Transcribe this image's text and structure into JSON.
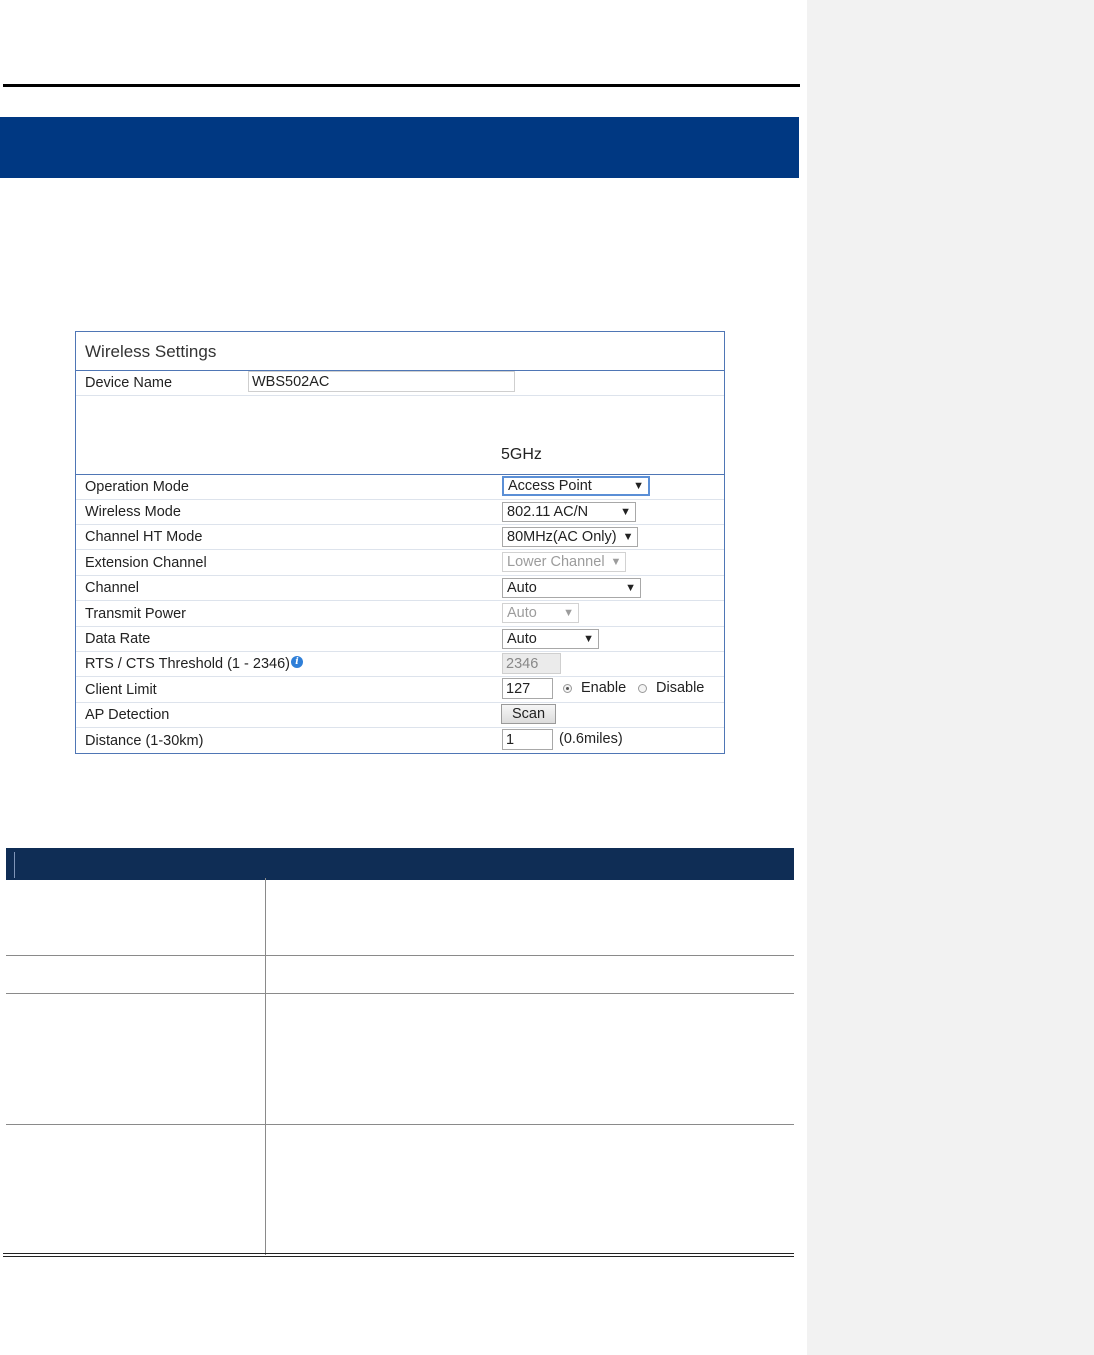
{
  "panel": {
    "title": "Wireless Settings",
    "device_name": {
      "label": "Device Name",
      "value": "WBS502AC"
    },
    "band_label": "5GHz",
    "rows": {
      "operation_mode": {
        "label": "Operation Mode",
        "value": "Access Point"
      },
      "wireless_mode": {
        "label": "Wireless Mode",
        "value": "802.11 AC/N"
      },
      "channel_ht_mode": {
        "label": "Channel HT Mode",
        "value": "80MHz(AC Only)"
      },
      "extension_channel": {
        "label": "Extension Channel",
        "value": "Lower Channel"
      },
      "channel": {
        "label": "Channel",
        "value": "Auto"
      },
      "transmit_power": {
        "label": "Transmit Power",
        "value": "Auto"
      },
      "data_rate": {
        "label": "Data Rate",
        "value": "Auto"
      },
      "rts_cts": {
        "label": "RTS / CTS Threshold (1 - 2346)",
        "value": "2346"
      },
      "client_limit": {
        "label": "Client Limit",
        "value": "127",
        "enable_label": "Enable",
        "disable_label": "Disable",
        "selected": "Enable"
      },
      "ap_detection": {
        "label": "AP Detection",
        "button": "Scan"
      },
      "distance": {
        "label": "Distance (1-30km)",
        "value": "1",
        "note": "(0.6miles)"
      }
    }
  },
  "icons": {
    "dropdown": "▼",
    "info": "i"
  },
  "colors": {
    "title_band": "#003882",
    "table_header": "#0f2d55",
    "panel_border": "#4f76b5",
    "comment_margin": "#f2f2f2"
  }
}
